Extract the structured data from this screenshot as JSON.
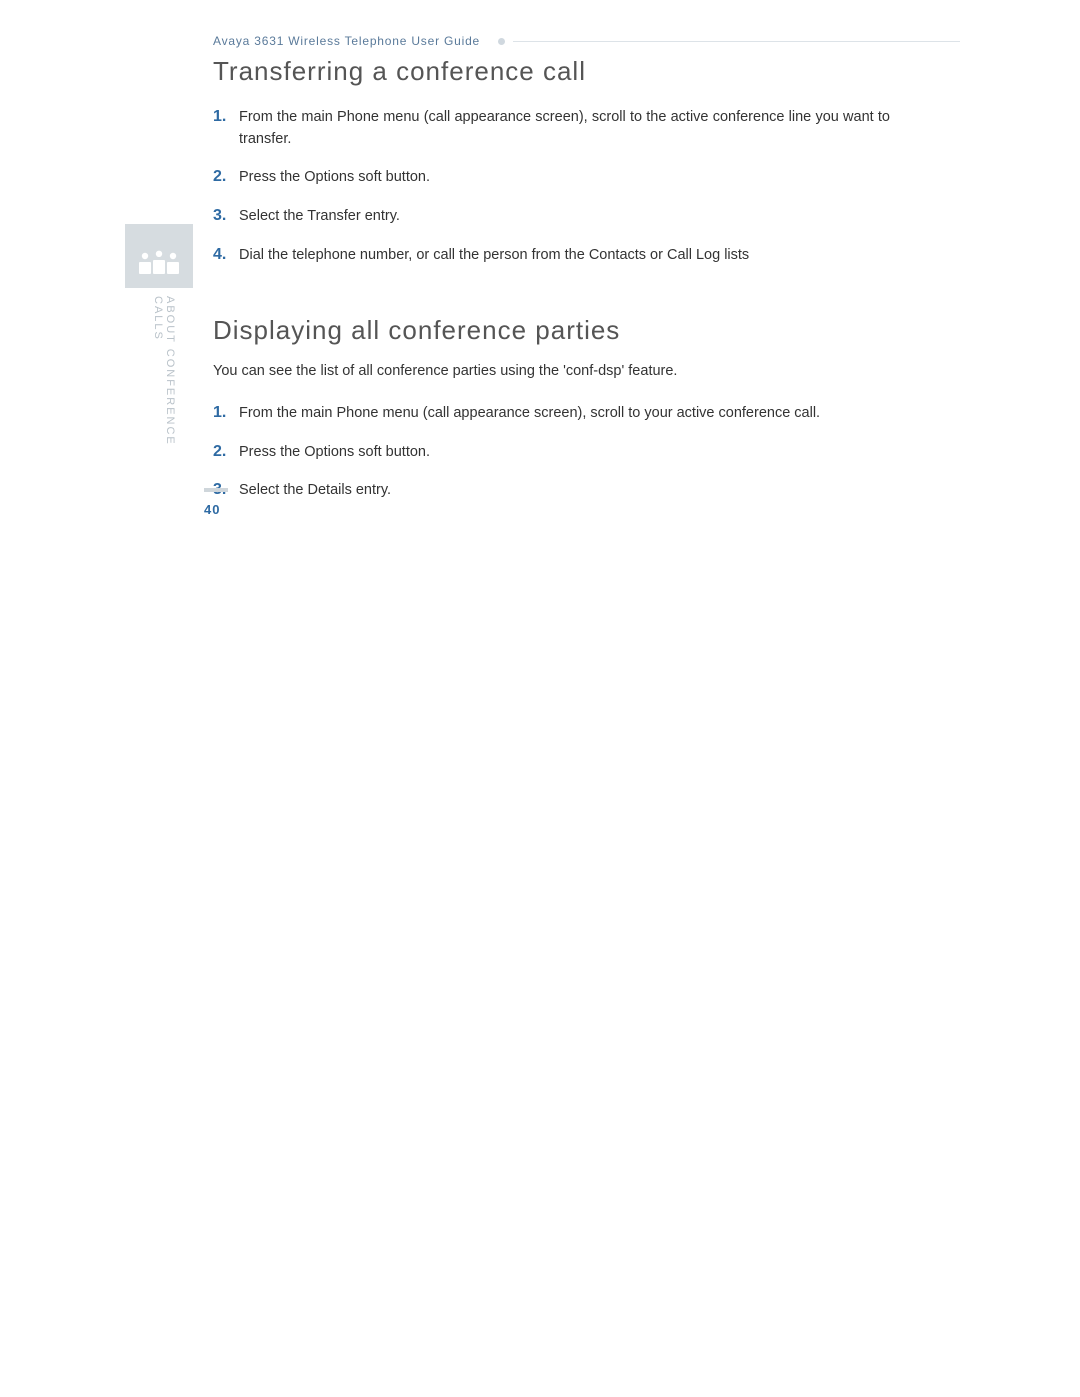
{
  "header": {
    "title": "Avaya 3631 Wireless Telephone User Guide"
  },
  "sidebar": {
    "label": "ABOUT CONFERENCE CALLS"
  },
  "section1": {
    "title": "Transferring a conference call",
    "steps": [
      {
        "num": "1.",
        "text": "From the main Phone menu (call appearance screen), scroll to the active conference line you want to transfer."
      },
      {
        "num": "2.",
        "text": "Press the Options soft button."
      },
      {
        "num": "3.",
        "text": "Select the Transfer entry."
      },
      {
        "num": "4.",
        "text": "Dial the telephone number, or call the person from the Contacts or Call Log lists"
      }
    ]
  },
  "section2": {
    "title": "Displaying all conference parties",
    "intro": "You can see the list of all conference parties using the 'conf-dsp' feature.",
    "steps": [
      {
        "num": "1.",
        "text": "From the main Phone menu (call appearance screen), scroll to your active conference call."
      },
      {
        "num": "2.",
        "text": "Press the Options soft button."
      },
      {
        "num": "3.",
        "text": "Select the Details entry."
      }
    ]
  },
  "page_number": "40"
}
